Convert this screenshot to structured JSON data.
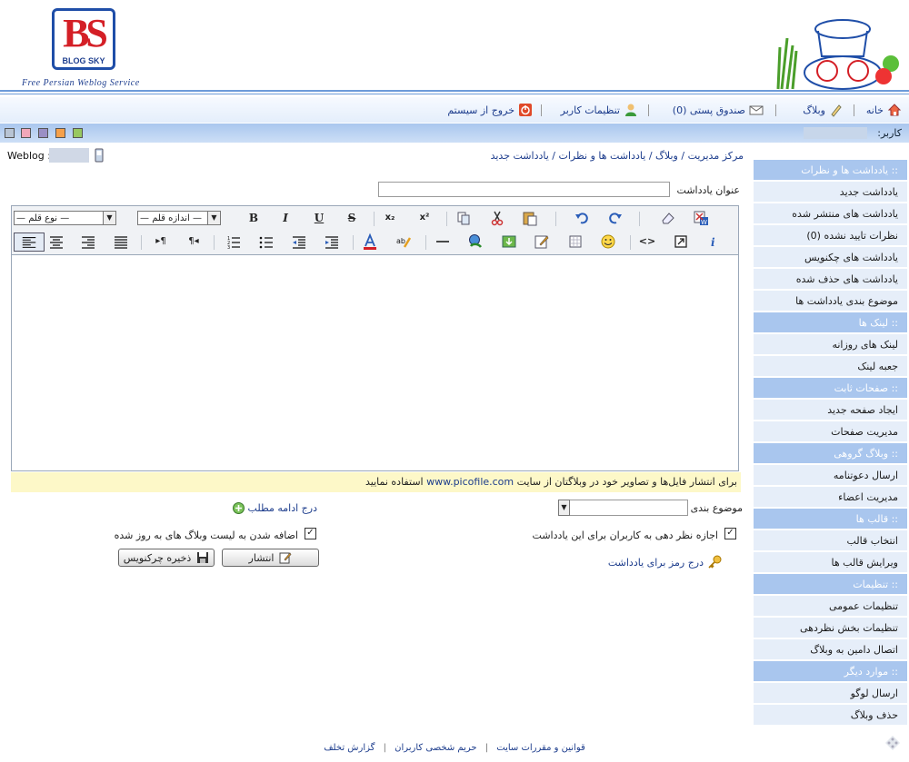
{
  "header": {
    "logo_text": "BS",
    "logo_subtext": "BLOG SKY",
    "tagline": "Free Persian Weblog Service"
  },
  "nav": {
    "home": "خانه",
    "weblog": "وبلاگ",
    "mailbox": "صندوق پستی (0)",
    "user_settings": "تنظیمات کاربر",
    "logout": "خروج از سیستم"
  },
  "userbar": {
    "user_label": "کاربر:"
  },
  "breadcrumb": {
    "home": "مرکز مدیریت",
    "weblog": "وبلاگ",
    "posts": "یادداشت ها و نظرات",
    "current": "یادداشت جدید",
    "separator": "/"
  },
  "weblog_label": "Weblog :",
  "sidebar": {
    "items": [
      {
        "type": "head",
        "label": ":: یادداشت ها و نظرات"
      },
      {
        "type": "link",
        "label": "یادداشت جدید"
      },
      {
        "type": "link",
        "label": "یادداشت های منتشر شده"
      },
      {
        "type": "link",
        "label": "نظرات تایید نشده (0)"
      },
      {
        "type": "link",
        "label": "یادداشت های چکنویس"
      },
      {
        "type": "link",
        "label": "یادداشت های حذف شده"
      },
      {
        "type": "link",
        "label": "موضوع بندی یادداشت ها"
      },
      {
        "type": "head",
        "label": ":: لینک ها"
      },
      {
        "type": "link",
        "label": "لینک های روزانه"
      },
      {
        "type": "link",
        "label": "جعبه لینک"
      },
      {
        "type": "head",
        "label": ":: صفحات ثابت"
      },
      {
        "type": "link",
        "label": "ایجاد صفحه جدید"
      },
      {
        "type": "link",
        "label": "مدیریت صفحات"
      },
      {
        "type": "head",
        "label": ":: وبلاگ گروهی"
      },
      {
        "type": "link",
        "label": "ارسال دعوتنامه"
      },
      {
        "type": "link",
        "label": "مدیریت اعضاء"
      },
      {
        "type": "head",
        "label": ":: قالب ها"
      },
      {
        "type": "link",
        "label": "انتخاب قالب"
      },
      {
        "type": "link",
        "label": "ویرایش قالب ها"
      },
      {
        "type": "head",
        "label": ":: تنظیمات"
      },
      {
        "type": "link",
        "label": "تنظیمات عمومی"
      },
      {
        "type": "link",
        "label": "تنظیمات بخش نظردهی"
      },
      {
        "type": "link",
        "label": "اتصال دامین به وبلاگ"
      },
      {
        "type": "head",
        "label": ":: موارد دیگر"
      },
      {
        "type": "link",
        "label": "ارسال لوگو"
      },
      {
        "type": "link",
        "label": "حذف وبلاگ"
      }
    ]
  },
  "form": {
    "title_label": "عنوان یادداشت",
    "title_value": "",
    "font_family_select": "— نوع قلم —",
    "font_size_select": "— اندازه قلم —",
    "info_text_pre": "برای انتشار فایل‌ها و تصاویر خود در وبلاگتان از سایت",
    "info_link": "www.picofile.com",
    "info_text_post": "استفاده نمایید",
    "category_label": "موضوع بندی",
    "more_link": "درج ادامه مطلب",
    "allow_comments_label": "اجازه نظر دهی به کاربران برای این یادداشت",
    "allow_comments_checked": "✓",
    "add_to_updated_label": "اضافه شدن به لیست وبلاگ های به روز شده",
    "add_to_updated_checked": "✓",
    "password_link": "درج رمز برای یادداشت",
    "publish_button": "انتشار",
    "draft_button": "ذخیره چرکنویس"
  },
  "toolbar": {
    "bold": "B",
    "italic": "I",
    "underline": "U",
    "strike": "S",
    "subscript": "x₂",
    "superscript": "x²",
    "source": "<>"
  },
  "footer": {
    "rules": "قوانین و مقررات سایت",
    "privacy": "حریم شخصی کاربران",
    "report": "گزارش تخلف",
    "separator": "|"
  },
  "colors": {
    "accent": "#a9c6ee",
    "sidebar_link_bg": "#e6eef9",
    "info_bg": "#fdf8c8",
    "logo_red": "#d41f26",
    "logo_blue": "#1f4ea8"
  }
}
